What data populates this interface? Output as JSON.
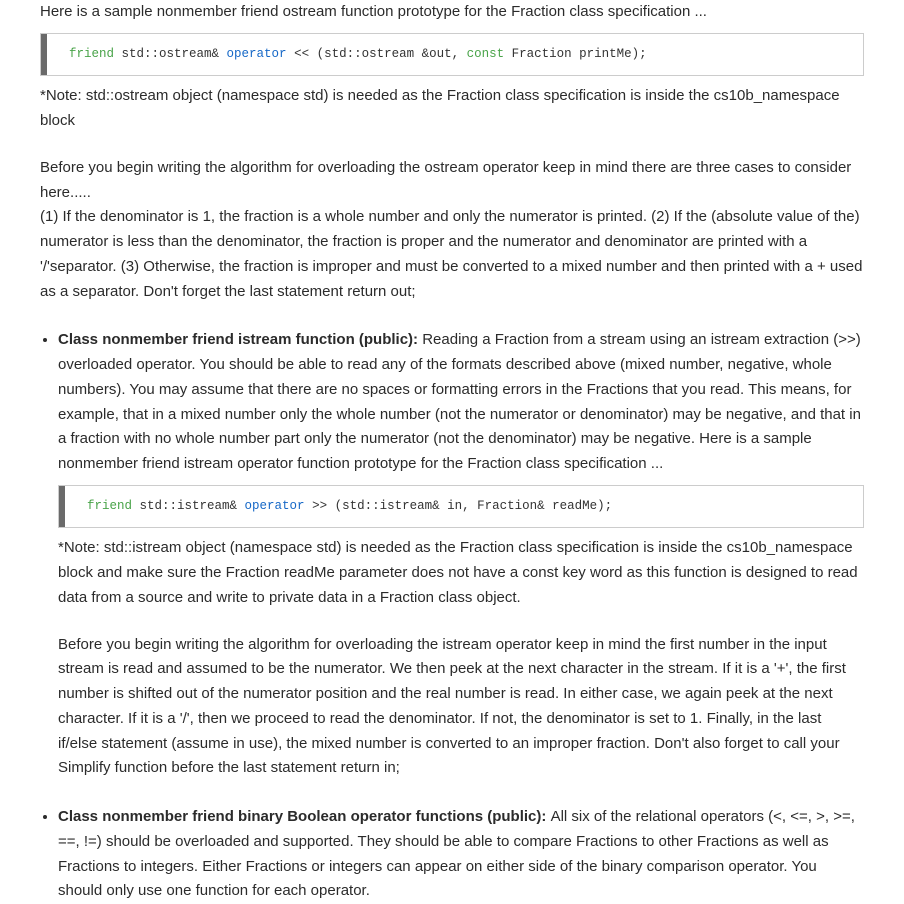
{
  "intro": {
    "p1": "Here is a sample nonmember friend ostream function prototype for the Fraction class specification ..."
  },
  "code1": {
    "kw_friend": "friend",
    "t1": " std::ostream& ",
    "kw_operator": "operator",
    "t2": " << (std::ostream &out, ",
    "kw_const": "const",
    "t3": " Fraction printMe);"
  },
  "note1": "*Note: std::ostream object (namespace std) is needed as the Fraction class specification is inside the cs10b_namespace block",
  "ostream_intro": "Before you begin writing the algorithm for overloading the ostream operator keep in mind there are three cases to consider here.....",
  "ostream_cases": "(1) If the denominator is 1, the fraction is a whole number and only the numerator is printed.  (2) If the (absolute value of the) numerator is less than the denominator, the fraction is proper and the numerator and denominator are printed with a '/'separator.  (3) Otherwise, the fraction is improper and must be converted to a mixed number and then printed with a + used as a separator. Don't forget the last statement return out;",
  "istream": {
    "lead": "Class nonmember friend istream function (public): ",
    "body": "Reading a Fraction from a stream using an istream extraction (>>) overloaded operator. You should be able to read any of the formats described above (mixed number, negative, whole numbers). You may assume that there are no spaces or formatting errors in the Fractions that you read. This means, for example, that in a mixed number only the whole number (not the numerator or denominator) may be negative, and that in a fraction with no whole number part only the numerator (not the denominator) may be negative. Here is a sample nonmember friend istream operator function prototype for the Fraction class specification ..."
  },
  "code2": {
    "kw_friend": "friend",
    "t1": " std::istream& ",
    "kw_operator": "operator",
    "t2": " >> (std::istream& in, Fraction& readMe);"
  },
  "note2": "*Note: std::istream object (namespace std) is needed as the Fraction class specification is inside the cs10b_namespace block  and make sure the Fraction readMe parameter does not have a const key word as this function is designed to read data from a source and write to private data in a Fraction class object.",
  "istream_algo": "Before you begin writing the algorithm for overloading the istream operator keep in mind the first number in the input stream is read and assumed to be the numerator. We then peek at the next character in the stream. If it is a '+', the first number is shifted out of the numerator position and the real number is read. In either case, we again peek at the next character. If it is a '/', then we proceed to read the denominator. If not, the denominator is set to 1. Finally, in the last if/else statement (assume in use), the mixed number is converted to an improper fraction. Don't also forget to call your Simplify function before the last statement return in;",
  "boolops": {
    "lead": "Class nonmember friend binary Boolean operator functions (public): ",
    "body": "All six of the relational operators (<, <=, >, >=, ==, !=) should be overloaded and supported. They should be able to compare Fractions to other Fractions as well as Fractions to integers. Either Fractions or integers can appear on either side of the binary comparison operator. You should only use one function for each operator."
  }
}
